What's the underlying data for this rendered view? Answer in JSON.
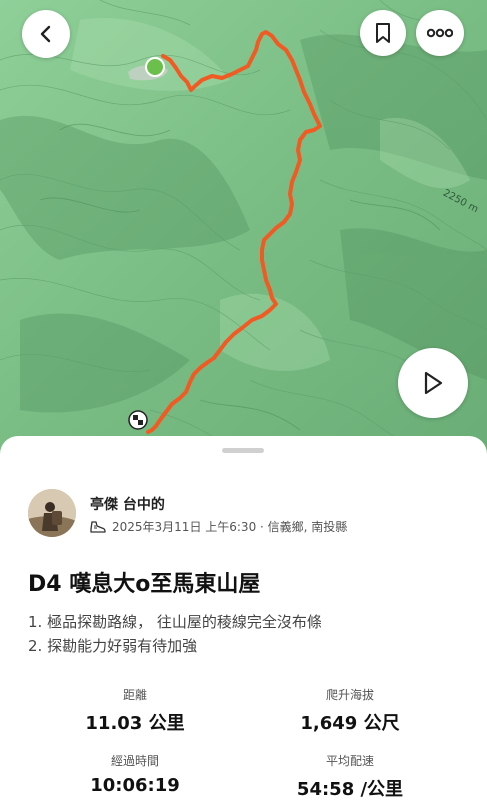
{
  "map": {
    "contour_label": "2250 m",
    "route_color": "#f15a22",
    "start_marker_color": "#6ac04a"
  },
  "header": {
    "back_icon": "chevron-left-icon",
    "bookmark_icon": "bookmark-icon",
    "more_icon": "more-horizontal-icon"
  },
  "play_icon": "play-icon",
  "activity": {
    "user_name": "亭傑 台中的",
    "activity_icon": "hiking-shoe-icon",
    "date_location": "2025年3月11日 上午6:30 · 信義鄉, 南投縣",
    "title": "D4 嘆息大o至馬東山屋",
    "description": [
      "1. 極品探勘路線， 往山屋的稜線完全沒布條",
      "2. 探勘能力好弱有待加強"
    ]
  },
  "stats": [
    {
      "label": "距離",
      "value": "11.03 公里"
    },
    {
      "label": "爬升海拔",
      "value": "1,649 公尺"
    },
    {
      "label": "經過時間",
      "value": "10:06:19"
    },
    {
      "label": "平均配速",
      "value": "54:58 /公里"
    }
  ]
}
